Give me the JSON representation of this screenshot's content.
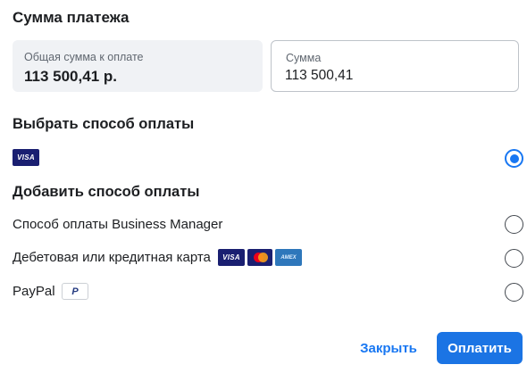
{
  "header": {
    "title": "Сумма платежа"
  },
  "total": {
    "label": "Общая сумма к оплате",
    "value": "113 500,41 р."
  },
  "amount": {
    "label": "Сумма",
    "value": "113 500,41"
  },
  "choose_method": {
    "title": "Выбрать способ оплаты",
    "saved": {
      "card_brand": "VISA",
      "selected": true
    }
  },
  "add_method": {
    "title": "Добавить способ оплаты",
    "options": [
      {
        "label": "Способ оплаты Business Manager",
        "selected": false
      },
      {
        "label": "Дебетовая или кредитная карта",
        "logos": [
          "VISA",
          "mastercard",
          "AMEX"
        ],
        "selected": false
      },
      {
        "label": "PayPal",
        "logo": "P",
        "selected": false
      }
    ]
  },
  "buttons": {
    "close_label": "Закрыть",
    "pay_label": "Оплатить"
  },
  "colors": {
    "accent": "#1877f2",
    "pay_button": "#1b74e4",
    "visa_blue": "#1a1f71",
    "amex_blue": "#2e77bb"
  }
}
